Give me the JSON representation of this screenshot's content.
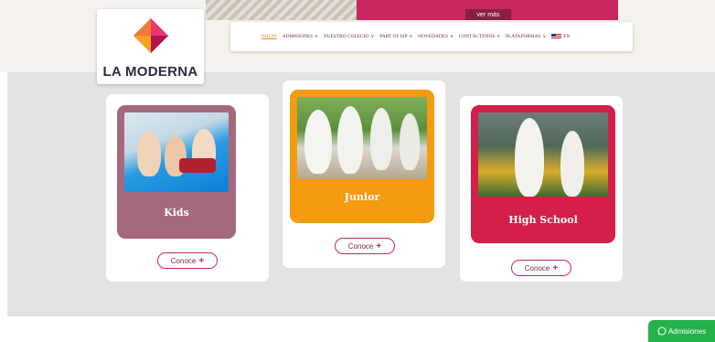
{
  "hero": {
    "ver_mas": "ver más"
  },
  "brand": {
    "name": "LA MODERNA"
  },
  "nav": {
    "items": [
      {
        "label": "INICIO",
        "active": true,
        "dropdown": false
      },
      {
        "label": "ADMISIONES",
        "active": false,
        "dropdown": true
      },
      {
        "label": "NUESTRO COLEGIO",
        "active": false,
        "dropdown": true
      },
      {
        "label": "PART OF ISP",
        "active": false,
        "dropdown": true
      },
      {
        "label": "NOVEDADES",
        "active": false,
        "dropdown": true
      },
      {
        "label": "CONTÁCTENOS",
        "active": false,
        "dropdown": true
      },
      {
        "label": "PLATAFORMAS",
        "active": false,
        "dropdown": true
      }
    ],
    "language": "EN"
  },
  "cards": [
    {
      "label": "Kids",
      "button": "Conoce",
      "color": "#a5697d"
    },
    {
      "label": "Junior",
      "button": "Conoce",
      "color": "#f49b10"
    },
    {
      "label": "High School",
      "button": "Conoce",
      "color": "#d41f48"
    }
  ],
  "whatsapp": {
    "label": "Admisiones",
    "color": "#25b14c"
  },
  "colors": {
    "accent": "#c8275f",
    "active_nav": "#e08a18",
    "brand_dark": "#2b2e3a"
  }
}
